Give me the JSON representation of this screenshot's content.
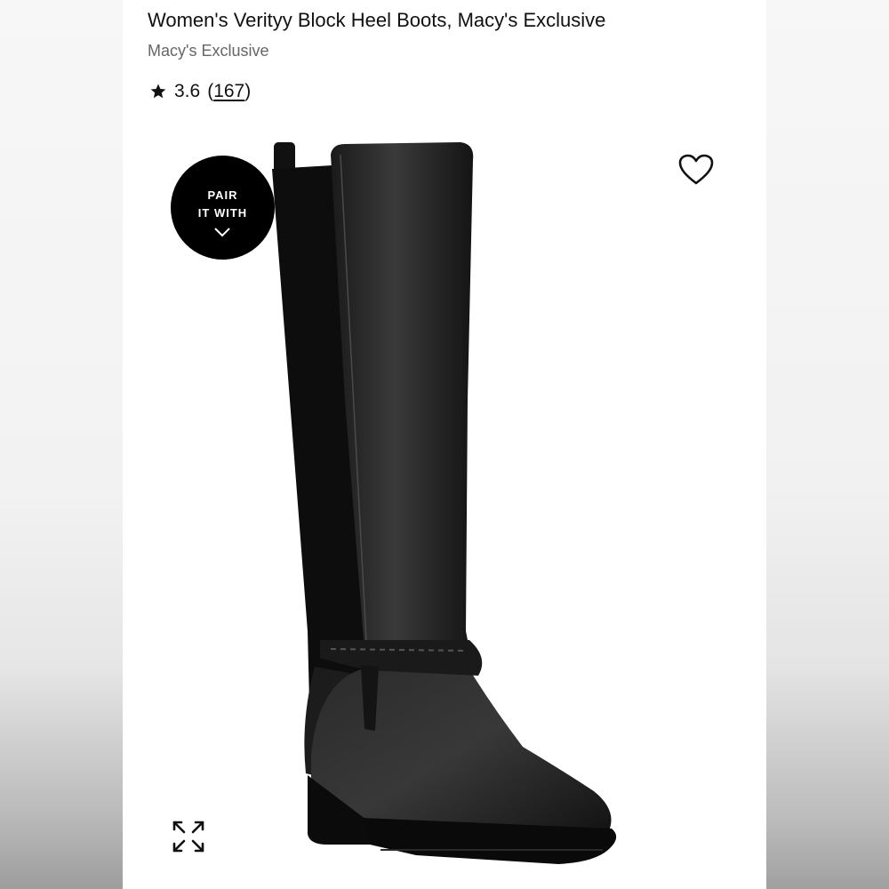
{
  "product": {
    "title": "Women's Verityy Block Heel Boots, Macy's Exclusive",
    "brand": "Macy's Exclusive",
    "rating_value": "3.6",
    "review_count": "167"
  },
  "pair_badge": {
    "line1": "PAIR",
    "line2": "IT WITH"
  },
  "icons": {
    "rating": "star-icon",
    "favorite": "heart-outline-icon",
    "pair_toggle": "chevron-down-icon",
    "expand": "expand-arrows-icon"
  },
  "colors": {
    "badge_bg": "#000000",
    "text": "#111111",
    "brand_text": "#666666"
  }
}
